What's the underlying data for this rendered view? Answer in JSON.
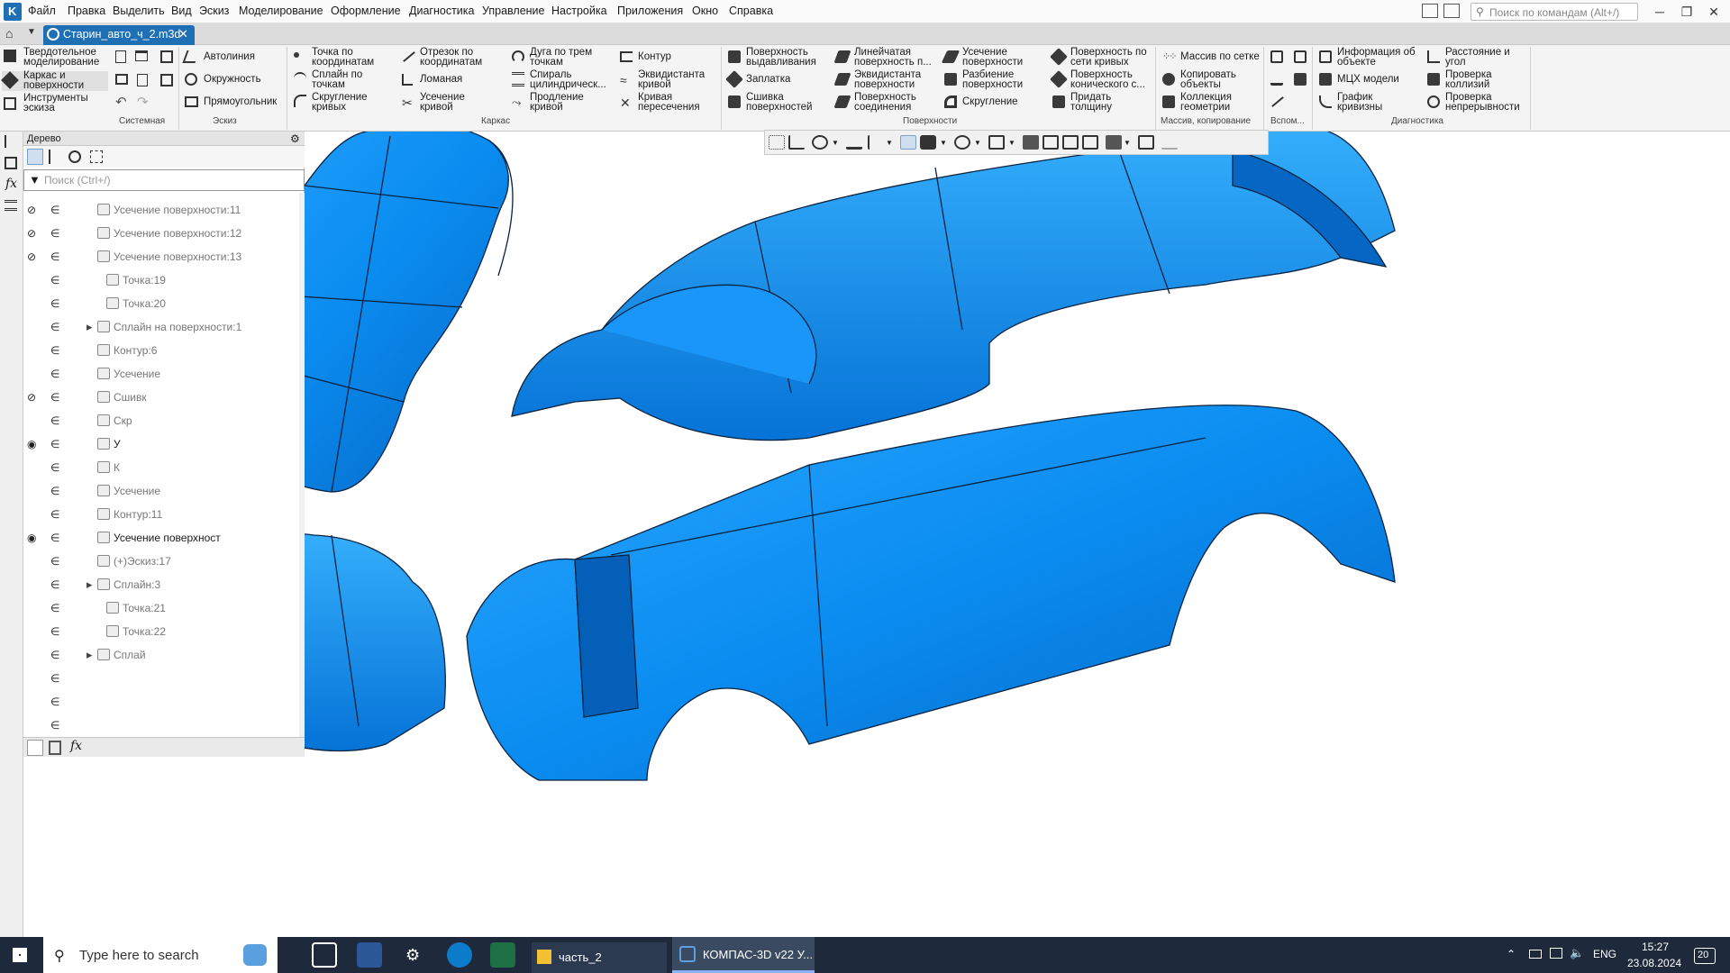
{
  "menu": {
    "items": [
      "Файл",
      "Правка",
      "Выделить",
      "Вид",
      "Эскиз",
      "Моделирование",
      "Оформление",
      "Диагностика",
      "Управление",
      "Настройка",
      "Приложения",
      "Окно",
      "Справка"
    ],
    "search_placeholder": "Поиск по командам (Alt+/)"
  },
  "document_tab": {
    "title": "Старин_авто_ч_2.m3d",
    "close": "✕"
  },
  "ribbon": {
    "modes": [
      "Твердотельное\nмоделирование",
      "Каркас и\nповерхности",
      "Инструменты\nэскиза"
    ],
    "sketch_tools": [
      "Автолиния",
      "Окружность",
      "Прямоугольник"
    ],
    "wire_col1": [
      "Точка по\nкоординатам",
      "Сплайн по\nточкам",
      "Скругление\nкривых"
    ],
    "wire_col2": [
      "Отрезок по\nкоординатам",
      "Ломаная",
      "Усечение\nкривой"
    ],
    "wire_col3": [
      "Дуга по трем\nточкам",
      "Спираль\nцилиндрическ...",
      "Продление\nкривой"
    ],
    "wire_col4": [
      "Контур",
      "Эквидистанта\nкривой",
      "Кривая\nпересечения"
    ],
    "surf_col1": [
      "Поверхность\nвыдавливания",
      "Заплатка",
      "Сшивка\nповерхностей"
    ],
    "surf_col2": [
      "Линейчатая\nповерхность п...",
      "Эквидистанта\nповерхности",
      "Поверхность\nсоединения"
    ],
    "surf_col3": [
      "Усечение\nповерхности",
      "Разбиение\nповерхности",
      "Скругление"
    ],
    "surf_col4": [
      "Поверхность по\nсети кривых",
      "Поверхность\nконического с...",
      "Придать\nтолщину"
    ],
    "array_col": [
      "Массив по сетке",
      "Копировать\nобъекты",
      "Коллекция\nгеометрии"
    ],
    "diag_col1": [
      "Информация об\nобъекте",
      "МЦХ модели",
      "График\nкривизны"
    ],
    "diag_col2": [
      "Расстояние и\nугол",
      "Проверка\nколлизий",
      "Проверка\nнепрерывности"
    ],
    "groups": [
      "Системная",
      "Эскиз",
      "Каркас",
      "Поверхности",
      "Массив, копирование",
      "Вспом...",
      "Диагностика"
    ]
  },
  "tree": {
    "title": "Дерево",
    "search_placeholder": "Поиск (Ctrl+/)",
    "rows": [
      {
        "label": "Усечение поверхности:11",
        "eye": "hidden",
        "indent": 1
      },
      {
        "label": "Усечение поверхности:12",
        "eye": "hidden",
        "indent": 1
      },
      {
        "label": "Усечение поверхности:13",
        "eye": "hidden",
        "indent": 1
      },
      {
        "label": "Точка:19",
        "eye": "",
        "indent": 2
      },
      {
        "label": "Точка:20",
        "eye": "",
        "indent": 2
      },
      {
        "label": "Сплайн на поверхности:1",
        "eye": "",
        "indent": 1,
        "expand": true
      },
      {
        "label": "Контур:6",
        "eye": "",
        "indent": 1
      },
      {
        "label": "Усечение",
        "eye": "",
        "indent": 1
      },
      {
        "label": "Сшивк",
        "eye": "hidden",
        "indent": 1
      },
      {
        "label": "Скр",
        "eye": "",
        "indent": 1
      },
      {
        "label": "У",
        "eye": "shown",
        "indent": 1,
        "dark": true
      },
      {
        "label": "К",
        "eye": "",
        "indent": 1
      },
      {
        "label": "Усечение",
        "eye": "",
        "indent": 1
      },
      {
        "label": "Контур:11",
        "eye": "",
        "indent": 1
      },
      {
        "label": "Усечение поверхност",
        "eye": "shown",
        "indent": 1,
        "dark": true
      },
      {
        "label": "(+)Эскиз:17",
        "eye": "",
        "indent": 1
      },
      {
        "label": "Сплайн:3",
        "eye": "",
        "indent": 1,
        "expand": true
      },
      {
        "label": "Точка:21",
        "eye": "",
        "indent": 2
      },
      {
        "label": "Точка:22",
        "eye": "",
        "indent": 2
      },
      {
        "label": "Сплай",
        "eye": "",
        "indent": 1,
        "expand": true
      },
      {
        "label": "",
        "eye": "",
        "indent": 1
      },
      {
        "label": "",
        "eye": "",
        "indent": 1
      },
      {
        "label": "",
        "eye": "",
        "indent": 1
      }
    ]
  },
  "taskbar": {
    "search_placeholder": "Type here to search",
    "folder_label": "часть_2",
    "kompas_label": "КОМПАС-3D v22 У...",
    "lang": "ENG",
    "time": "15:27",
    "date": "23.08.2024",
    "notifications": "20"
  },
  "colors": {
    "accent": "#1f6fb5",
    "model": "#0a8cf0",
    "model_dark": "#0666c2",
    "taskbar": "#1e2a3b"
  }
}
